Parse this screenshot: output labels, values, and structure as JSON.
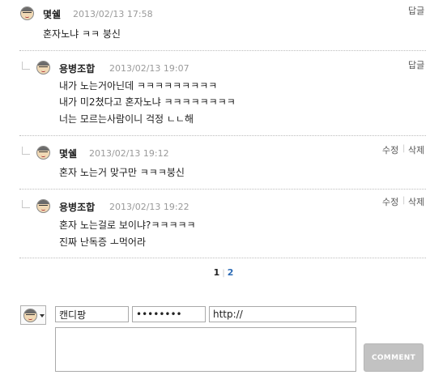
{
  "comments": [
    {
      "author": "몇쉘",
      "date": "2013/02/13 17:58",
      "lines": [
        "혼자노냐 ㅋㅋ 붕신"
      ],
      "actions": [
        "답글"
      ]
    },
    {
      "author": "용병조합",
      "date": "2013/02/13 19:07",
      "lines": [
        "내가 노는거아닌데 ㅋㅋㅋㅋㅋㅋㅋㅋㅋ",
        "내가 미2쳤다고 혼자노냐 ㅋㅋㅋㅋㅋㅋㅋㅋ",
        "너는 모르는사람이니 걱정 ㄴㄴ해"
      ],
      "actions": [
        "답글"
      ]
    },
    {
      "author": "몇쉘",
      "date": "2013/02/13 19:12",
      "lines": [
        "혼자 노는거 맞구만 ㅋㅋㅋ붕신"
      ],
      "actions": [
        "수정",
        "삭제"
      ]
    },
    {
      "author": "용병조합",
      "date": "2013/02/13 19:22",
      "lines": [
        "혼자 노는걸로 보이냐?ㅋㅋㅋㅋㅋ",
        "진짜 난독증 ㅗ먹어라"
      ],
      "actions": [
        "수정",
        "삭제"
      ]
    }
  ],
  "pagination": {
    "current": "1",
    "next": "2"
  },
  "form": {
    "name_value": "캔디팡",
    "password_value": "password",
    "url_value": "http://",
    "comment_value": "",
    "submit_label": "COMMENT"
  },
  "icons": {
    "avatar": "old-man-avatar-icon",
    "dropdown": "caret-down-icon",
    "reply": "reply-indent-icon"
  },
  "colors": {
    "date": "#9a9a9a",
    "page_link": "#2c6bb5",
    "submit_bg": "#c2c2c2"
  }
}
